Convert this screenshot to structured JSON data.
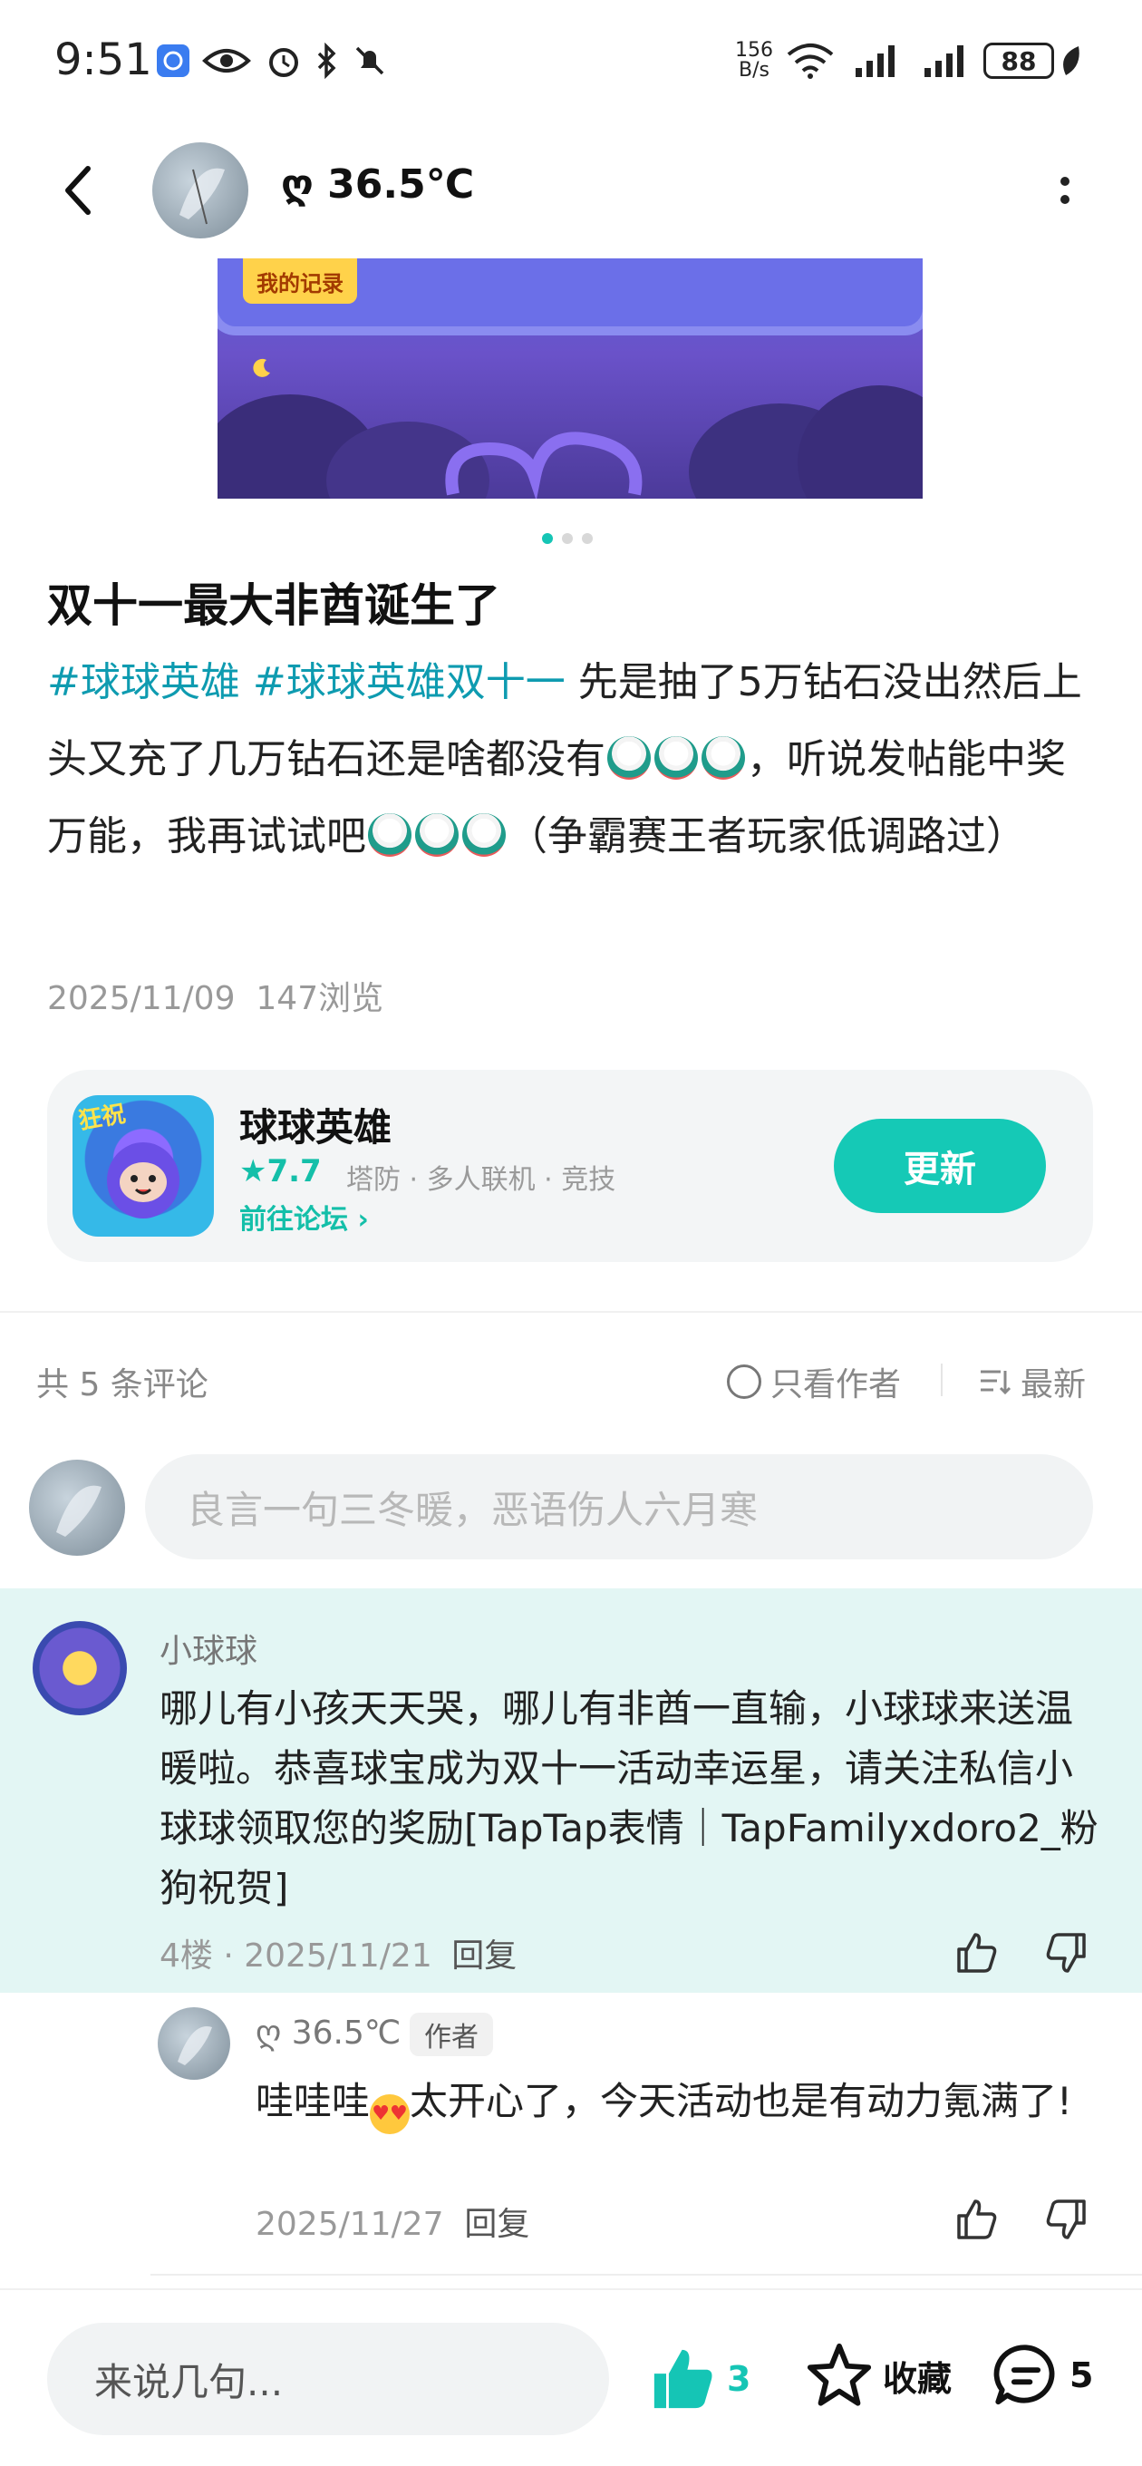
{
  "status_bar": {
    "time": "9:51",
    "net_speed_top": "156",
    "net_speed_bottom": "B/s",
    "battery": "88",
    "icons": [
      "app-notification-icon",
      "eye-icon",
      "alarm-icon",
      "bluetooth-icon",
      "mute-icon",
      "wifi-icon",
      "signal-icon",
      "signal-icon",
      "battery-icon",
      "leaf-icon"
    ]
  },
  "header": {
    "author_name": "ღ 36.5℃"
  },
  "banner": {
    "tag_text": "我的记录",
    "slide_count": 3,
    "active_slide": 1
  },
  "post": {
    "title": "双十一最大非酋诞生了",
    "tags": [
      "#球球英雄",
      "#球球英雄双十一"
    ],
    "body_part1": "先是抽了5万钻石没出然后上头又充了几万钻石还是啥都没有",
    "body_part2": "，听说发帖能中奖万能，我再试试吧",
    "body_part3": "（争霸赛王者玩家低调路过）",
    "date": "2025/11/09",
    "views": "147浏览"
  },
  "game_card": {
    "icon_badge": "狂祝",
    "name": "球球英雄",
    "rating": "7.7",
    "tags": [
      "塔防",
      "多人联机",
      "竞技"
    ],
    "forum_link": "前往论坛",
    "button_label": "更新"
  },
  "comments_header": {
    "count_label": "共 5 条评论",
    "only_author_label": "只看作者",
    "sort_label": "最新"
  },
  "comment_input": {
    "placeholder": "良言一句三冬暖，恶语伤人六月寒"
  },
  "comments": [
    {
      "name": "小球球",
      "text": "哪儿有小孩天天哭，哪儿有非酋一直输，小球球来送温暖啦。恭喜球宝成为双十一活动幸运星，请关注私信小球球领取您的奖励[TapTap表情｜TapFamilyxdoro2_粉狗祝贺]",
      "floor": "4楼",
      "date": "2025/11/21",
      "reply_label": "回复"
    }
  ],
  "replies": [
    {
      "name": "ღ 36.5℃",
      "badge": "作者",
      "text_before": "哇哇哇",
      "text_after": "太开心了，今天活动也是有动力氪满了!",
      "date": "2025/11/27",
      "reply_label": "回复"
    }
  ],
  "bottom_bar": {
    "input_placeholder": "来说几句...",
    "like_count": "3",
    "favorite_label": "收藏",
    "comment_count": "5"
  },
  "colors": {
    "accent": "#15c5b5",
    "tag_link": "#0e9bb0",
    "highlight_bg": "#e3f6f4"
  }
}
